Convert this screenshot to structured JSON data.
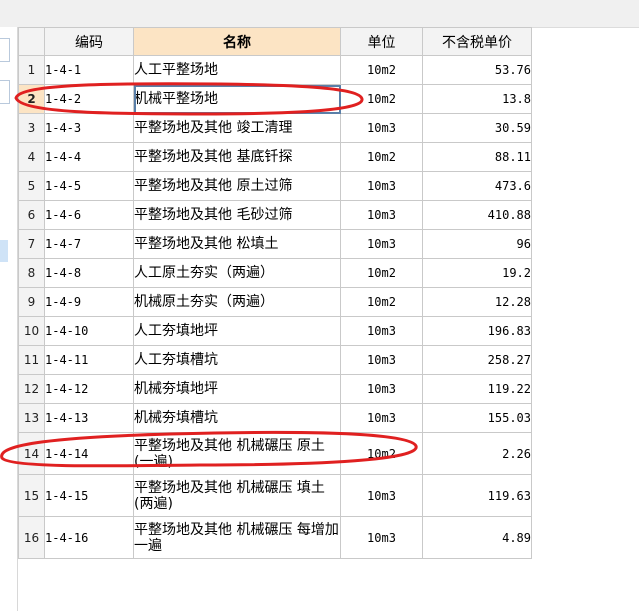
{
  "columns": {
    "code": "编码",
    "name": "名称",
    "unit": "单位",
    "price": "不含税单价"
  },
  "rows": [
    {
      "idx": "1",
      "code": "1-4-1",
      "name": "人工平整场地",
      "unit": "10m2",
      "price": "53.76"
    },
    {
      "idx": "2",
      "code": "1-4-2",
      "name": "机械平整场地",
      "unit": "10m2",
      "price": "13.8"
    },
    {
      "idx": "3",
      "code": "1-4-3",
      "name": "平整场地及其他 竣工清理",
      "unit": "10m3",
      "price": "30.59"
    },
    {
      "idx": "4",
      "code": "1-4-4",
      "name": "平整场地及其他 基底钎探",
      "unit": "10m2",
      "price": "88.11"
    },
    {
      "idx": "5",
      "code": "1-4-5",
      "name": "平整场地及其他 原土过筛",
      "unit": "10m3",
      "price": "473.6"
    },
    {
      "idx": "6",
      "code": "1-4-6",
      "name": "平整场地及其他 毛砂过筛",
      "unit": "10m3",
      "price": "410.88"
    },
    {
      "idx": "7",
      "code": "1-4-7",
      "name": "平整场地及其他 松填土",
      "unit": "10m3",
      "price": "96"
    },
    {
      "idx": "8",
      "code": "1-4-8",
      "name": "人工原土夯实（两遍）",
      "unit": "10m2",
      "price": "19.2"
    },
    {
      "idx": "9",
      "code": "1-4-9",
      "name": "机械原土夯实（两遍）",
      "unit": "10m2",
      "price": "12.28"
    },
    {
      "idx": "10",
      "code": "1-4-10",
      "name": "人工夯填地坪",
      "unit": "10m3",
      "price": "196.83"
    },
    {
      "idx": "11",
      "code": "1-4-11",
      "name": "人工夯填槽坑",
      "unit": "10m3",
      "price": "258.27"
    },
    {
      "idx": "12",
      "code": "1-4-12",
      "name": "机械夯填地坪",
      "unit": "10m3",
      "price": "119.22"
    },
    {
      "idx": "13",
      "code": "1-4-13",
      "name": "机械夯填槽坑",
      "unit": "10m3",
      "price": "155.03"
    },
    {
      "idx": "14",
      "code": "1-4-14",
      "name": "平整场地及其他 机械碾压 原土(一遍)",
      "unit": "10m2",
      "price": "2.26"
    },
    {
      "idx": "15",
      "code": "1-4-15",
      "name": "平整场地及其他 机械碾压 填土(两遍)",
      "unit": "10m3",
      "price": "119.63"
    },
    {
      "idx": "16",
      "code": "1-4-16",
      "name": "平整场地及其他 机械碾压 每增加一遍",
      "unit": "10m3",
      "price": "4.89"
    }
  ],
  "selected_row": "2",
  "annotation_color": "#e02020"
}
